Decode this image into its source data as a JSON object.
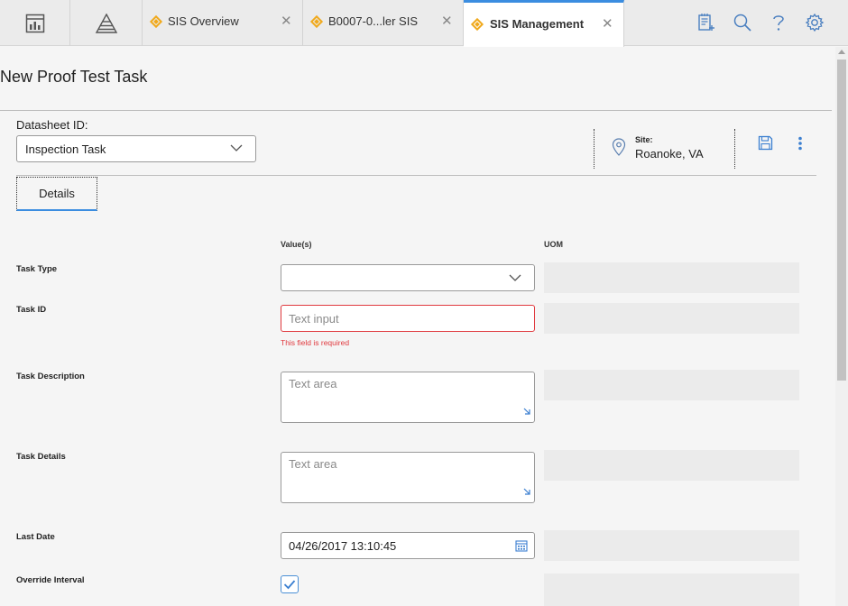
{
  "topbar": {
    "tabs": [
      {
        "label": "SIS Overview",
        "close": "✕"
      },
      {
        "label": "B0007-0...ler SIS",
        "close": "✕"
      },
      {
        "label": "SIS Management",
        "close": "✕"
      }
    ],
    "icons": [
      "dashboard-icon",
      "hierarchy-icon",
      "add-notes-icon",
      "search-icon",
      "help-icon",
      "settings-icon"
    ]
  },
  "page": {
    "title": "New Proof Test Task"
  },
  "datasheet": {
    "label": "Datasheet ID:",
    "value": "Inspection Task"
  },
  "site": {
    "label": "Site:",
    "value": "Roanoke, VA"
  },
  "tabs": {
    "details": "Details"
  },
  "columns": {
    "values": "Value(s)",
    "uom": "UOM"
  },
  "fields": {
    "task_type": {
      "label": "Task Type",
      "value": ""
    },
    "task_id": {
      "label": "Task ID",
      "placeholder": "Text input",
      "error": "This field is required"
    },
    "task_description": {
      "label": "Task Description",
      "placeholder": "Text area"
    },
    "task_details": {
      "label": "Task Details",
      "placeholder": "Text area"
    },
    "last_date": {
      "label": "Last Date",
      "value": "04/26/2017 13:10:45"
    },
    "override_interval": {
      "label": "Override Interval",
      "checked": true
    }
  },
  "colors": {
    "accent": "#3b8de0",
    "error": "#e0393e",
    "tab_diamond": "#f0a91c"
  }
}
